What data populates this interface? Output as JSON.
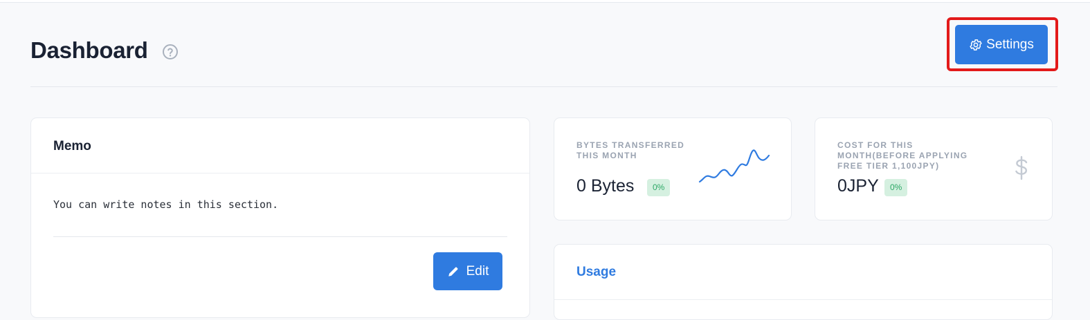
{
  "header": {
    "title": "Dashboard",
    "help_icon": "question-circle-icon",
    "settings_label": "Settings",
    "settings_icon": "gear-icon"
  },
  "memo": {
    "title": "Memo",
    "body": "You can write notes in this section.",
    "edit_label": "Edit",
    "edit_icon": "pencil-icon"
  },
  "stats": {
    "bytes": {
      "label": "BYTES TRANSFERRED THIS MONTH",
      "value": "0 Bytes",
      "badge": "0%",
      "icon": "sparkline-chart-icon"
    },
    "cost": {
      "label": "COST FOR THIS MONTH(BEFORE APPLYING FREE TIER 1,100JPY)",
      "value": "0JPY",
      "badge": "0%",
      "icon": "dollar-icon"
    }
  },
  "usage": {
    "title": "Usage"
  },
  "colors": {
    "accent": "#2f7be0",
    "highlight": "#e31a1a",
    "badge_bg": "#d5f0e0",
    "badge_text": "#2da866"
  }
}
